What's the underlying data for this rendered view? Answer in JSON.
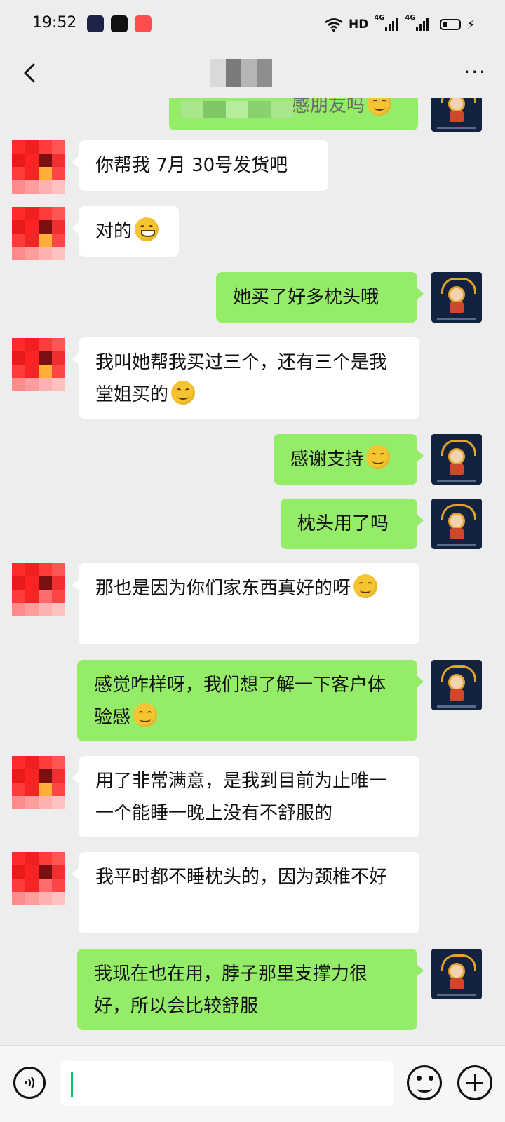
{
  "status_bar": {
    "time": "19:52",
    "network_label": "HD",
    "sim1_label": "4G",
    "sim2_label": "4G"
  },
  "header": {
    "back_icon": "chevron-left-icon",
    "title": "",
    "more_icon": "more-dots-icon",
    "more_label": "···"
  },
  "messages": [
    {
      "side": "out",
      "text": "感朋友吗",
      "emoji": "thinking",
      "partial": true
    },
    {
      "side": "in",
      "text": "你帮我 7月 30号发货吧"
    },
    {
      "side": "in",
      "text": "对的",
      "emoji": "grin"
    },
    {
      "side": "out",
      "text": "她买了好多枕头哦"
    },
    {
      "side": "in",
      "text": "我叫她帮我买过三个，还有三个是我堂姐买的",
      "emoji": "thinking"
    },
    {
      "side": "out",
      "text": "感谢支持",
      "emoji": "smile"
    },
    {
      "side": "out",
      "text": "枕头用了吗"
    },
    {
      "side": "in",
      "text": "那也是因为你们家东西真好的呀",
      "emoji": "smile"
    },
    {
      "side": "out",
      "text": "感觉咋样呀，我们想了解一下客户体验感",
      "emoji": "thinking"
    },
    {
      "side": "in",
      "text": "用了非常满意，是我到目前为止唯一一个能睡一晚上没有不舒服的"
    },
    {
      "side": "in",
      "text": "我平时都不睡枕头的，因为颈椎不好"
    },
    {
      "side": "out",
      "text": "我现在也在用，脖子那里支撑力很好，所以会比较舒服"
    }
  ],
  "input_bar": {
    "voice_icon": "voice-icon",
    "input_value": "",
    "emoji_icon": "emoji-icon",
    "plus_icon": "plus-icon"
  },
  "colors": {
    "chat_bg": "#ededed",
    "incoming_bubble": "#ffffff",
    "outgoing_bubble": "#95ec69",
    "caret": "#07c160"
  }
}
